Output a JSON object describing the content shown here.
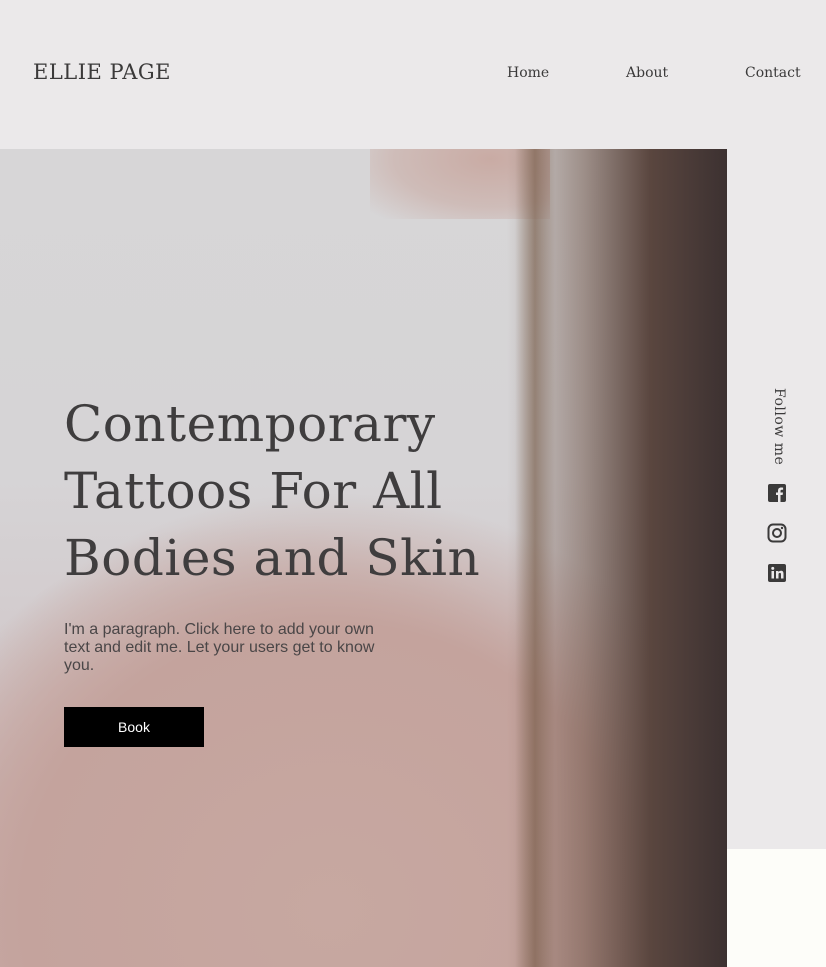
{
  "header": {
    "logo": "ELLIE PAGE",
    "nav": [
      {
        "label": "Home"
      },
      {
        "label": "About"
      },
      {
        "label": "Contact"
      }
    ]
  },
  "hero": {
    "title": "Contemporary Tattoos For All Bodies and Skin",
    "paragraph": "I'm a paragraph. Click here to add your own text and edit me. Let your users get to know you.",
    "button_label": "Book"
  },
  "social": {
    "label": "Follow me",
    "icons": [
      "facebook-icon",
      "instagram-icon",
      "linkedin-icon"
    ],
    "icon_color": "#3b3a3a"
  },
  "colors": {
    "background": "#ebe9ea",
    "button": "#000000",
    "button_text": "#ffffff",
    "text": "#3f3d3e"
  }
}
